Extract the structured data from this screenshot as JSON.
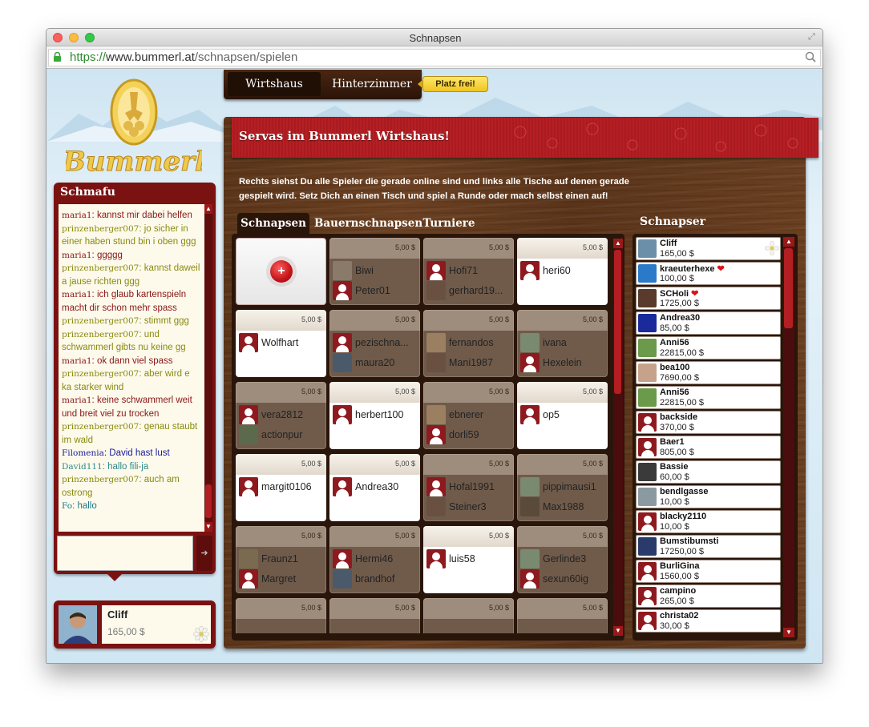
{
  "browser": {
    "title": "Schnapsen",
    "url_https": "https://",
    "url_host": "www.bummerl.at",
    "url_path": "/schnapsen/spielen"
  },
  "logo": {
    "text": "Bummerl"
  },
  "nav": {
    "wirtshaus": "Wirtshaus",
    "hinterzimmer": "Hinterzimmer",
    "badge": "Platz frei!"
  },
  "chat": {
    "title": "Schmafu",
    "messages": [
      {
        "nick": "maria1",
        "text": "kannst mir dabei helfen",
        "color": "maria"
      },
      {
        "nick": "prinzenberger007",
        "text": "jo sicher in einer haben stund bin i oben ggg",
        "color": "prinz"
      },
      {
        "nick": "maria1",
        "text": "ggggg",
        "color": "maria"
      },
      {
        "nick": "prinzenberger007",
        "text": "kannst daweil a jause richten ggg",
        "color": "prinz"
      },
      {
        "nick": "maria1",
        "text": "ich glaub kartenspieln macht dir schon mehr spass",
        "color": "maria"
      },
      {
        "nick": "prinzenberger007",
        "text": "stimmt ggg",
        "color": "prinz"
      },
      {
        "nick": "prinzenberger007",
        "text": "und schwammerl gibts nu keine gg",
        "color": "prinz"
      },
      {
        "nick": "maria1",
        "text": "ok dann viel spass",
        "color": "maria"
      },
      {
        "nick": "prinzenberger007",
        "text": "aber wird e ka starker wind",
        "color": "prinz"
      },
      {
        "nick": "maria1",
        "text": "keine schwammerl weit und breit viel zu trocken",
        "color": "maria"
      },
      {
        "nick": "prinzenberger007",
        "text": "genau staubt im wald",
        "color": "prinz"
      },
      {
        "nick": "Filomenia",
        "text": "David hast lust",
        "color": "filo"
      },
      {
        "nick": "David111",
        "text": "hallo fili-ja",
        "color": "david"
      },
      {
        "nick": "prinzenberger007",
        "text": "auch am ostrong",
        "color": "prinz"
      },
      {
        "nick": "Fo",
        "text": "hallo",
        "color": "fo"
      }
    ],
    "send_icon": "send-arrow-icon"
  },
  "me": {
    "name": "Cliff",
    "money": "165,00 $"
  },
  "board": {
    "banner": "Servas im Bummerl Wirtshaus!",
    "intro": "Rechts siehst Du alle Spieler die gerade online sind und links alle Tische auf denen gerade gespielt wird. Setz Dich an einen Tisch und spiel a Runde oder mach selbst einen auf!",
    "tabs": [
      "Schnapsen",
      "Bauernschnapsen",
      "Turniere"
    ],
    "players_title": "Schnapser"
  },
  "tables": [
    {
      "price": "",
      "players": [],
      "new": true
    },
    {
      "price": "5,00 $",
      "players": [
        "Biwi",
        "Peter01"
      ]
    },
    {
      "price": "5,00 $",
      "players": [
        "Hofi71",
        "gerhard19..."
      ]
    },
    {
      "price": "5,00 $",
      "players": [
        "heri60"
      ],
      "free": true
    },
    {
      "price": "5,00 $",
      "players": [
        "Wolfhart"
      ],
      "free": true
    },
    {
      "price": "5,00 $",
      "players": [
        "pezischna...",
        "maura20"
      ]
    },
    {
      "price": "5,00 $",
      "players": [
        "fernandos",
        "Mani1987"
      ]
    },
    {
      "price": "5,00 $",
      "players": [
        "ivana",
        "Hexelein"
      ]
    },
    {
      "price": "5,00 $",
      "players": [
        "vera2812",
        "actionpur"
      ]
    },
    {
      "price": "5,00 $",
      "players": [
        "herbert100"
      ],
      "free": true
    },
    {
      "price": "5,00 $",
      "players": [
        "ebnerer",
        "dorli59"
      ]
    },
    {
      "price": "5,00 $",
      "players": [
        "op5"
      ],
      "free": true
    },
    {
      "price": "5,00 $",
      "players": [
        "margit0106"
      ],
      "free": true
    },
    {
      "price": "5,00 $",
      "players": [
        "Andrea30"
      ],
      "free": true
    },
    {
      "price": "5,00 $",
      "players": [
        "Hofal1991",
        "Steiner3"
      ]
    },
    {
      "price": "5,00 $",
      "players": [
        "pippimausi1",
        "Max1988"
      ]
    },
    {
      "price": "5,00 $",
      "players": [
        "Fraunz1",
        "Margret"
      ]
    },
    {
      "price": "5,00 $",
      "players": [
        "Hermi46",
        "brandhof"
      ]
    },
    {
      "price": "5,00 $",
      "players": [
        "luis58"
      ],
      "free": true
    },
    {
      "price": "5,00 $",
      "players": [
        "Gerlinde3",
        "sexun60ig"
      ]
    },
    {
      "price": "5,00 $",
      "players": []
    },
    {
      "price": "5,00 $",
      "players": []
    },
    {
      "price": "5,00 $",
      "players": []
    },
    {
      "price": "5,00 $",
      "players": []
    }
  ],
  "players": [
    {
      "name": "Cliff",
      "money": "165,00 $",
      "heart": false,
      "av": "#6b8fa8"
    },
    {
      "name": "kraeuterhexe",
      "money": "100,00 $",
      "heart": true,
      "av": "#2b7ac9"
    },
    {
      "name": "SCHoli",
      "money": "1725,00 $",
      "heart": true,
      "av": "#5a3a2a"
    },
    {
      "name": "Andrea30",
      "money": "85,00 $",
      "heart": false,
      "av": "#1a2a9a"
    },
    {
      "name": "Anni56",
      "money": "22815,00 $",
      "heart": false,
      "av": "#6a9a4a"
    },
    {
      "name": "bea100",
      "money": "7690,00 $",
      "heart": false,
      "av": "#c7a28a"
    },
    {
      "name": "Anni56",
      "money": "22815,00 $",
      "heart": false,
      "av": "#6a9a4a"
    },
    {
      "name": "backside",
      "money": "370,00 $",
      "heart": false,
      "av": "red"
    },
    {
      "name": "Baer1",
      "money": "805,00 $",
      "heart": false,
      "av": "red"
    },
    {
      "name": "Bassie",
      "money": "60,00 $",
      "heart": false,
      "av": "#3a3a3a"
    },
    {
      "name": "bendlgasse",
      "money": "10,00 $",
      "heart": false,
      "av": "#8a9aa0"
    },
    {
      "name": "blacky2110",
      "money": "10,00 $",
      "heart": false,
      "av": "red"
    },
    {
      "name": "Bumstibumsti",
      "money": "17250,00 $",
      "heart": false,
      "av": "#2a3a6a"
    },
    {
      "name": "BurliGina",
      "money": "1560,00 $",
      "heart": false,
      "av": "red"
    },
    {
      "name": "campino",
      "money": "265,00 $",
      "heart": false,
      "av": "red"
    },
    {
      "name": "christa02",
      "money": "30,00 $",
      "heart": false,
      "av": "red"
    }
  ]
}
